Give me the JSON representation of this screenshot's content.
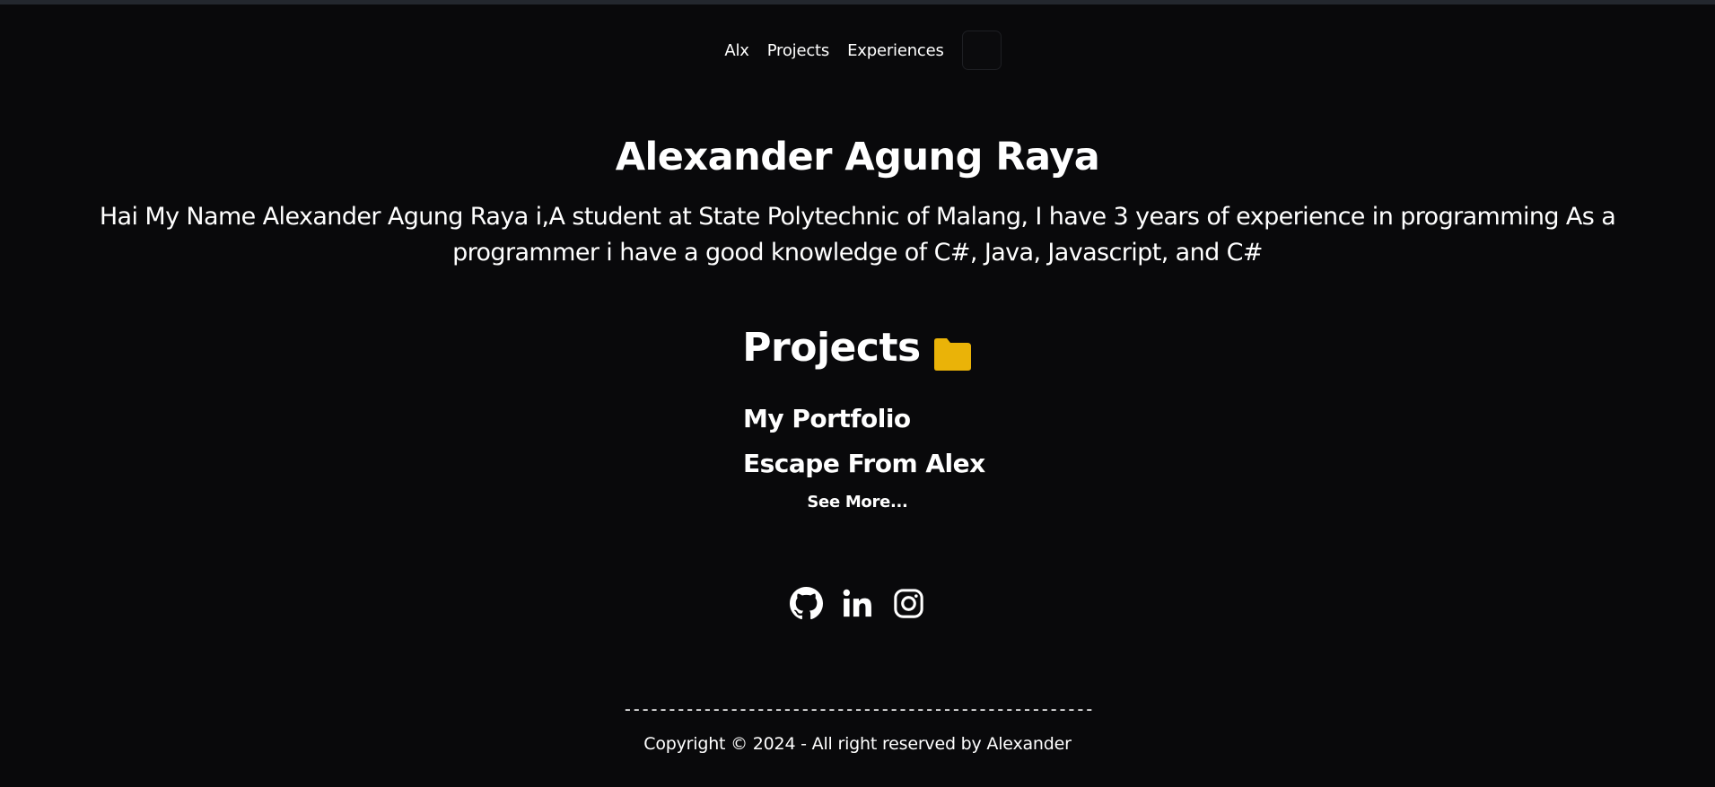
{
  "nav": {
    "items": [
      {
        "label": "Alx"
      },
      {
        "label": "Projects"
      },
      {
        "label": "Experiences"
      }
    ]
  },
  "hero": {
    "title": "Alexander Agung Raya",
    "description": "Hai My Name Alexander Agung Raya i,A student at State Polytechnic of Malang, I have 3 years of experience in programming As a programmer i have a good knowledge of C#, Java, Javascript, and C#"
  },
  "projects": {
    "heading": "Projects",
    "icon": "folder-icon",
    "items": [
      {
        "title": "My Portfolio"
      },
      {
        "title": "Escape From Alex"
      }
    ],
    "see_more": "See More..."
  },
  "socials": [
    {
      "icon": "github-icon"
    },
    {
      "icon": "linkedin-icon"
    },
    {
      "icon": "instagram-icon"
    }
  ],
  "footer": {
    "divider": "-----------------------------------------------------",
    "copyright": "Copyright © 2024 - All right reserved by Alexander"
  },
  "colors": {
    "background": "#09090b",
    "text": "#ffffff",
    "folder": "#eab308"
  }
}
